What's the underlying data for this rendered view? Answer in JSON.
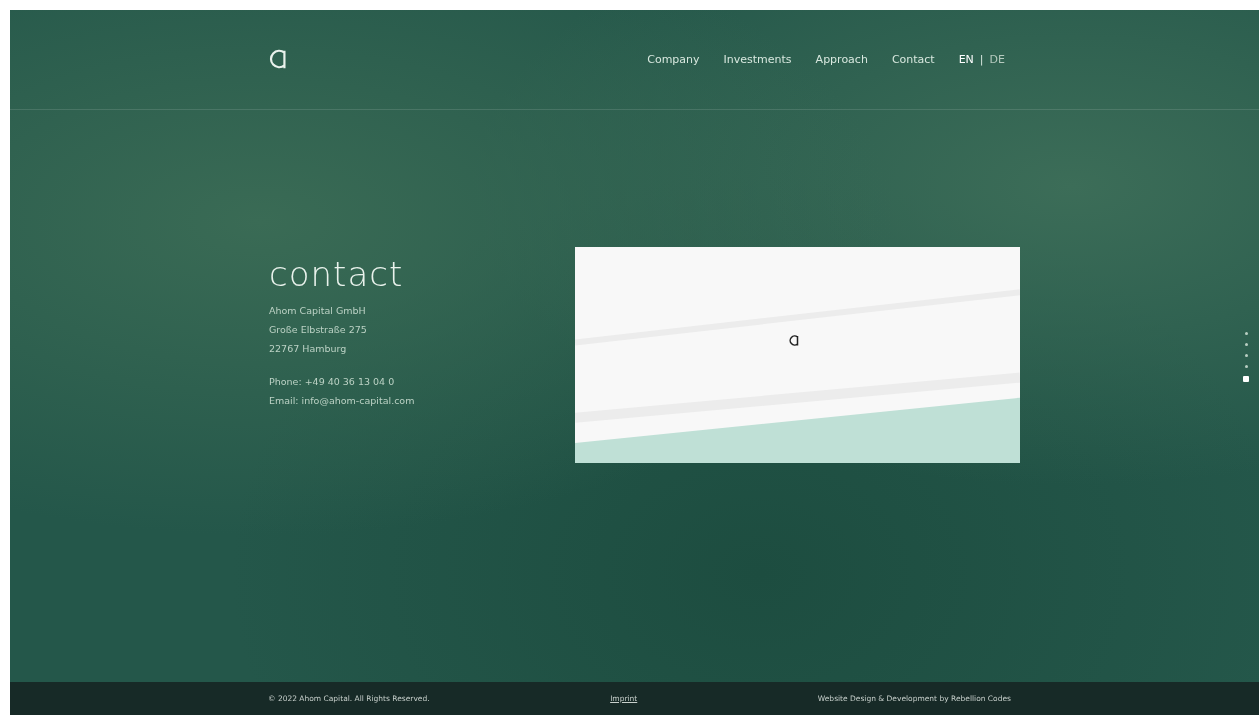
{
  "nav": {
    "items": [
      {
        "label": "Company"
      },
      {
        "label": "Investments"
      },
      {
        "label": "Approach"
      },
      {
        "label": "Contact"
      }
    ],
    "languages": [
      {
        "label": "EN",
        "selected": true
      },
      {
        "label": "DE",
        "selected": false
      }
    ],
    "separator": "|"
  },
  "contact": {
    "heading": "contact",
    "address": [
      "Ahom Capital GmbH",
      "Große Elbstraße 275",
      "22767 Hamburg"
    ],
    "details": [
      "Phone: +49 40 36 13 04 0",
      "Email: info@ahom-capital.com"
    ]
  },
  "section_dots": [
    {
      "selected": false
    },
    {
      "selected": false
    },
    {
      "selected": false
    },
    {
      "selected": false
    },
    {
      "selected": true
    }
  ],
  "footer": {
    "copyright": "© 2022 Ahom Capital. All Rights Reserved.",
    "imprint": "Imprint",
    "credit": "Website Design & Development by Rebellion Codes"
  }
}
